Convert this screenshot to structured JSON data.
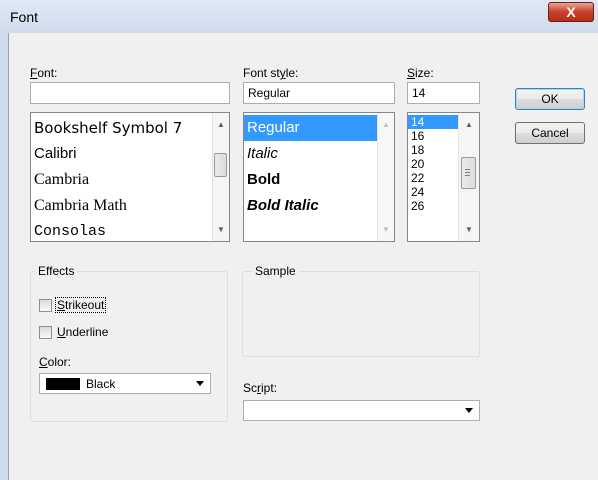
{
  "dialog": {
    "title": "Font",
    "close_glyph": "X"
  },
  "font": {
    "label_prefix": "F",
    "label_rest": "ont:",
    "value": "",
    "items": [
      "Bookshelf Symbol 7",
      "Calibri",
      "Cambria",
      "Cambria Math",
      "Consolas"
    ]
  },
  "style": {
    "label_pre": "Font st",
    "label_u": "y",
    "label_post": "le:",
    "value": "Regular",
    "items": [
      "Regular",
      "Italic",
      "Bold",
      "Bold Italic"
    ],
    "selected": "Regular"
  },
  "size": {
    "label_u": "S",
    "label_rest": "ize:",
    "value": "14",
    "items": [
      "14",
      "16",
      "18",
      "20",
      "22",
      "24",
      "26"
    ],
    "selected": "14"
  },
  "buttons": {
    "ok": "OK",
    "cancel": "Cancel"
  },
  "effects": {
    "title": "Effects",
    "strikeout_u": "S",
    "strikeout_rest": "trikeout",
    "underline_u": "U",
    "underline_rest": "nderline",
    "strikeout_checked": false,
    "underline_checked": false,
    "color_label_u": "C",
    "color_label_rest": "olor:",
    "color_value": "Black",
    "color_swatch": "#000000"
  },
  "sample": {
    "title": "Sample"
  },
  "script": {
    "label_pre": "Sc",
    "label_u": "r",
    "label_post": "ipt:",
    "value": ""
  },
  "colors": {
    "selection": "#3399ff",
    "title_bar": "#dfe9f5",
    "close_button": "#c7412a"
  }
}
